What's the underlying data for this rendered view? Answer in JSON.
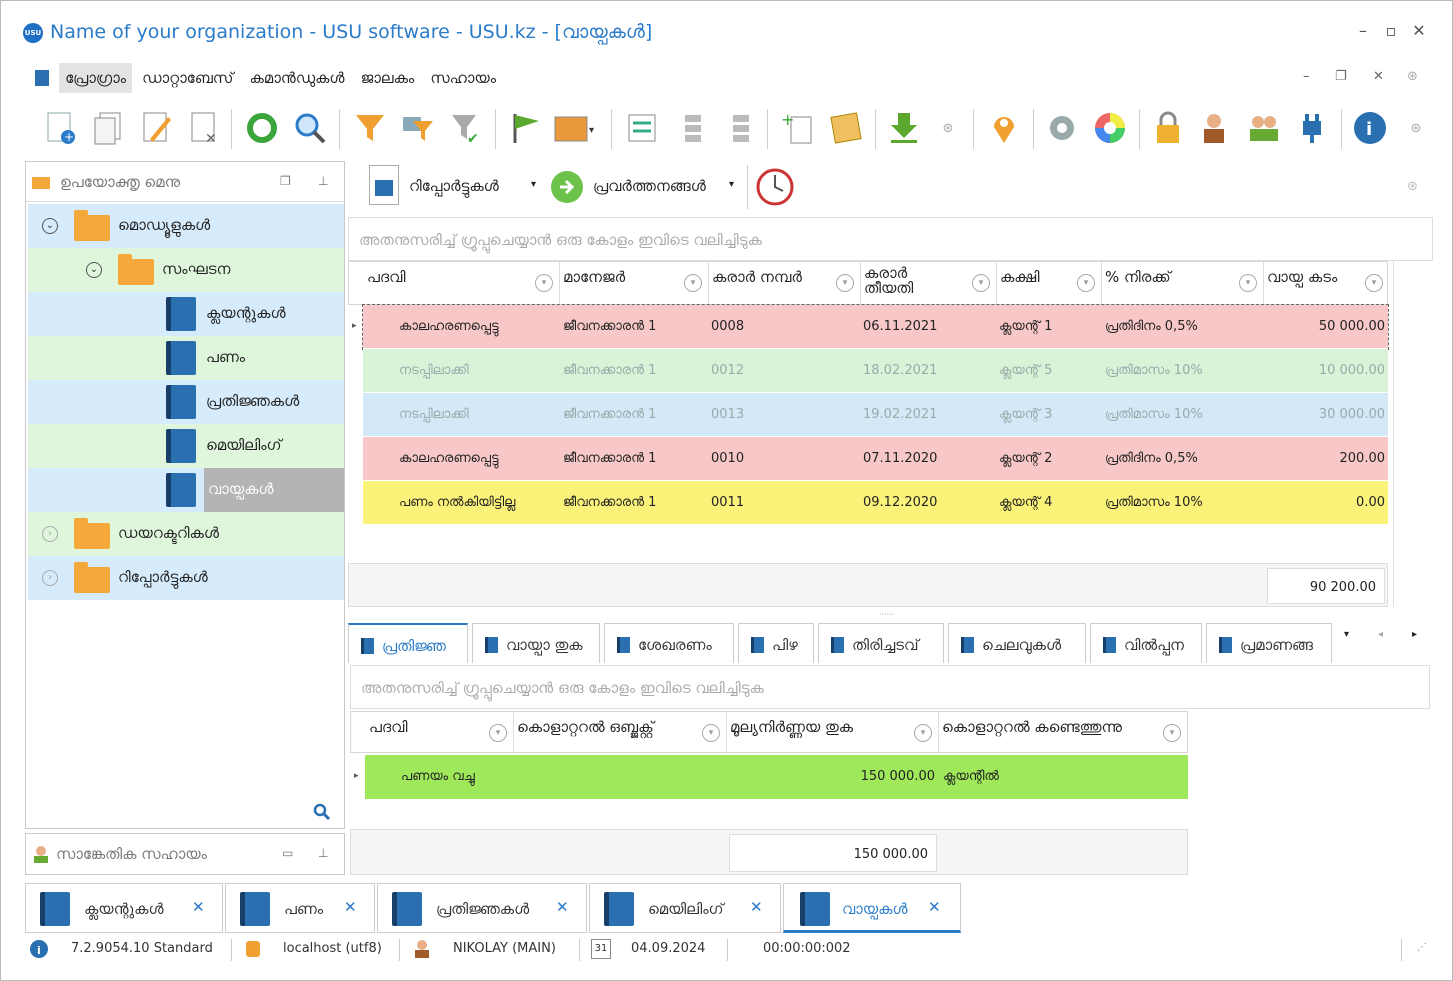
{
  "window": {
    "title": "Name of your organization - USU software - USU.kz - [വായ്പകൾ]",
    "logo": "USU"
  },
  "menu": [
    "പ്രോഗ്രാം",
    "ഡാറ്റാബേസ്",
    "കമാൻഡുകൾ",
    "ജാലകം",
    "സഹായം"
  ],
  "left_panel": {
    "title": "ഉപയോക്തൃ മെനു",
    "tree": {
      "modules": "മൊഡ്യൂളുകൾ",
      "organization": "സംഘടന",
      "clients": "ക്ലയന്റുകൾ",
      "money": "പണം",
      "pledges": "പ്രതിജ്ഞകൾ",
      "mailing": "മെയിലിംഗ്",
      "loans": "വായ്പകൾ",
      "directories": "ഡയറക്ടറികൾ",
      "reports": "റിപ്പോർട്ടുകൾ"
    }
  },
  "support_panel": {
    "title": "സാങ്കേതിക സഹായം"
  },
  "main_toolbar": {
    "reports": "റിപ്പോർട്ടുകൾ",
    "actions": "പ്രവർത്തനങ്ങൾ"
  },
  "group_hint": "അതനുസരിച്ച് ഗ്രൂപ്പുചെയ്യാൻ ഒരു കോളം ഇവിടെ വലിച്ചിടുക",
  "grid": {
    "columns": [
      "പദവി",
      "മാനേജർ",
      "കരാർ നമ്പർ",
      "കരാർ തീയതി",
      "കക്ഷി",
      "% നിരക്ക്",
      "വായ്പ കടം"
    ],
    "rows": [
      {
        "status": "കാലഹരണപ്പെട്ടു",
        "manager": "ജീവനക്കാരൻ 1",
        "number": "0008",
        "date": "06.11.2021",
        "client": "ക്ലയന്റ് 1",
        "rate": "പ്രതിദിനം 0,5%",
        "debt": "50 000.00",
        "color": "#f8c8c8",
        "muted": false
      },
      {
        "status": "നടപ്പിലാക്കി",
        "manager": "ജീവനക്കാരൻ 1",
        "number": "0012",
        "date": "18.02.2021",
        "client": "ക്ലയന്റ് 5",
        "rate": "പ്രതിമാസം 10%",
        "debt": "10 000.00",
        "color": "#d8f3d8",
        "muted": true
      },
      {
        "status": "നടപ്പിലാക്കി",
        "manager": "ജീവനക്കാരൻ 1",
        "number": "0013",
        "date": "19.02.2021",
        "client": "ക്ലയന്റ് 3",
        "rate": "പ്രതിമാസം 10%",
        "debt": "30 000.00",
        "color": "#d3e9f8",
        "muted": true
      },
      {
        "status": "കാലഹരണപ്പെട്ടു",
        "manager": "ജീവനക്കാരൻ 1",
        "number": "0010",
        "date": "07.11.2020",
        "client": "ക്ലയന്റ് 2",
        "rate": "പ്രതിദിനം 0,5%",
        "debt": "200.00",
        "color": "#f8c8c8",
        "muted": false
      },
      {
        "status": "പണം നൽകിയിട്ടില്ല",
        "manager": "ജീവനക്കാരൻ 1",
        "number": "0011",
        "date": "09.12.2020",
        "client": "ക്ലയന്റ് 4",
        "rate": "പ്രതിമാസം 10%",
        "debt": "0.00",
        "color": "#fbf27a",
        "muted": false
      }
    ],
    "total": "90 200.00"
  },
  "detail_tabs": [
    "പ്രതിജ്ഞ",
    "വായ്പാ തുക",
    "ശേഖരണം",
    "പിഴ",
    "തിരിച്ചടവ്",
    "ചെലവുകൾ",
    "വിൽപ്പന",
    "പ്രമാണങ്ങ"
  ],
  "detail_grid": {
    "columns": [
      "പദവി",
      "കൊളാറ്ററൽ ഒബ്ജക്റ്റ്",
      "മൂല്യനിർണ്ണയ തുക",
      "കൊളാറ്ററൽ കണ്ടെത്തുന്നു"
    ],
    "row": {
      "status": "പണയം വച്ചു",
      "object": "",
      "amount": "150 000.00",
      "location": "ക്ലയന്റിൽ"
    },
    "total": "150 000.00"
  },
  "open_tabs": [
    "ക്ലയന്റുകൾ",
    "പണം",
    "പ്രതിജ്ഞകൾ",
    "മെയിലിംഗ്",
    "വായ്പകൾ"
  ],
  "status": {
    "version": "7.2.9054.10 Standard",
    "db": "localhost (utf8)",
    "user": "NIKOLAY (MAIN)",
    "date_icon": "31",
    "date": "04.09.2024",
    "timer": "00:00:00:002"
  },
  "colors": {
    "accent": "#2a7bc9",
    "tree_blue": "#d6ebfb",
    "tree_green": "#dff5dc",
    "detail_row": "#9ee85a"
  }
}
